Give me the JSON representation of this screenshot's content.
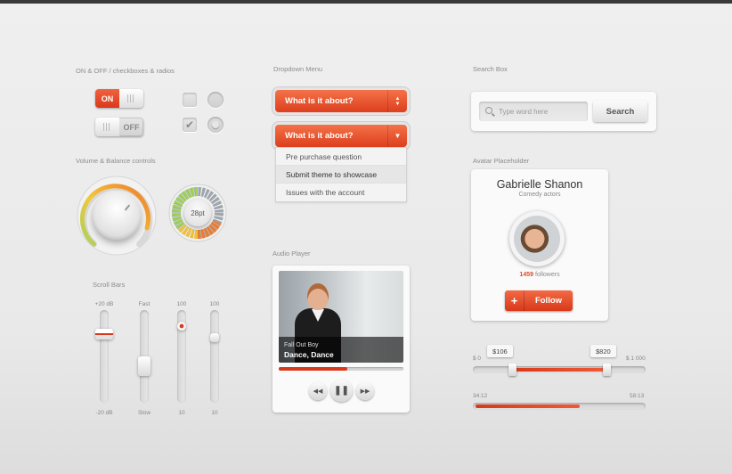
{
  "sections": {
    "onoff": "ON & OFF / checkboxes & radios",
    "dropdown": "Dropdown Menu",
    "search": "Search Box",
    "volume": "Volume & Balance controls",
    "avatar": "Avatar Placeholder",
    "audio": "Audio Player",
    "scroll": "Scroll Bars"
  },
  "toggles": {
    "on_label": "ON",
    "off_label": "OFF"
  },
  "checkboxes": [
    {
      "checked": false
    },
    {
      "checked": true
    }
  ],
  "radios": [
    {
      "selected": false
    },
    {
      "selected": true
    }
  ],
  "balance": {
    "label": "28pt"
  },
  "dropdown": {
    "closed_label": "What is it about?",
    "open_label": "What is it about?",
    "items": [
      "Pre purchase question",
      "Submit theme to showcase",
      "Issues with the account"
    ],
    "highlighted_index": 1
  },
  "search": {
    "placeholder": "Type word here",
    "button": "Search"
  },
  "profile": {
    "name": "Gabrielle Shanon",
    "role": "Comedy actors",
    "followers_count": "1459",
    "followers_label": "followers",
    "follow_button": "Follow"
  },
  "scrollbars": [
    {
      "top": "+20 dB",
      "bottom": "-20 dB",
      "value": 0.75
    },
    {
      "top": "Fast",
      "bottom": "Slow",
      "value": 0.35
    },
    {
      "top": "100",
      "bottom": "10",
      "value": 0.85
    },
    {
      "top": "100",
      "bottom": "10",
      "value": 0.7
    }
  ],
  "audio": {
    "artist": "Fall Out Boy",
    "song": "Dance, Dance",
    "progress": 0.55
  },
  "price_range": {
    "min_label": "$ 0",
    "max_label": "$ 1 000",
    "low": "$106",
    "high": "$820",
    "low_value": 106,
    "high_value": 820,
    "max": 1000
  },
  "timeline": {
    "start": "34:12",
    "end": "58:13",
    "progress": 0.62
  },
  "colors": {
    "accent": "#e04a2a",
    "background": "#ececec"
  }
}
